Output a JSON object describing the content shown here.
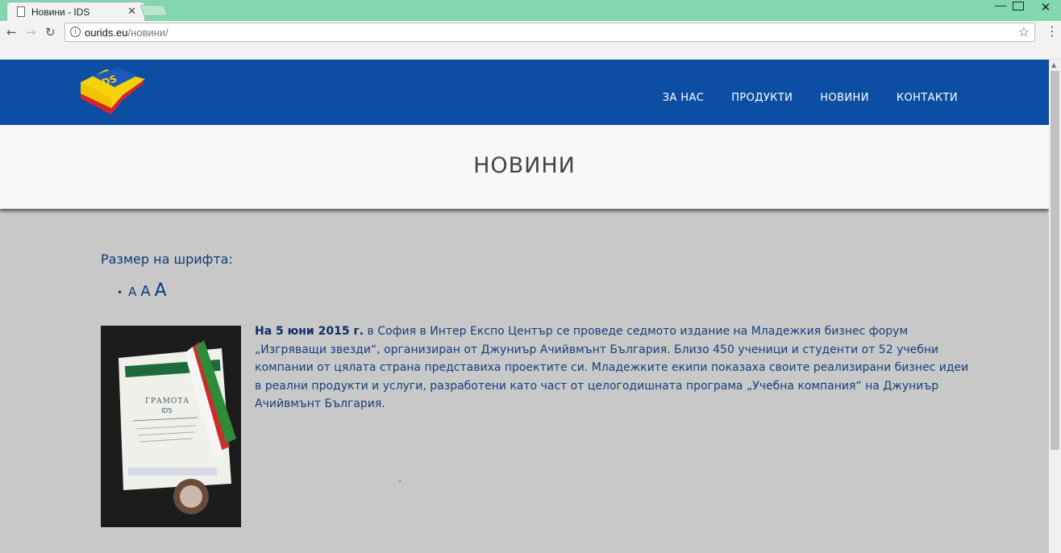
{
  "browser": {
    "tab_title": "Новини - IDS",
    "tab_close": "✕",
    "url_host": "ourids.eu",
    "url_path": "/новини/"
  },
  "site": {
    "logo_text": "IDS",
    "nav": [
      "ЗА НАС",
      "ПРОДУКТИ",
      "НОВИНИ",
      "КОНТАКТИ"
    ],
    "page_title": "НОВИНИ"
  },
  "font_size": {
    "label": "Размер на шрифта:",
    "options": [
      "A",
      "A",
      "A"
    ]
  },
  "article": {
    "date_bold": "На 5 юни 2015 г.",
    "text": " в София в Интер Експо Център се проведе седмото издание на Младежкия бизнес форум „Изгряващи звезди“, организиран от Джуниър Ачийвмънт България. Близо 450 ученици и студенти от 52 учебни компании от цялата страна представиха проектите си. Младежките екипи показаха своите реализирани бизнес идеи в реални продукти и услуги, разработени като част от целогодишната програма „Учебна компания“ на Джуниър Ачийвмънт България.",
    "photo": {
      "certificate_title": "ГРАМОТА",
      "certificate_name": "IDS"
    }
  },
  "colors": {
    "header_bg": "#0c4ea3",
    "titlebar": "#80d7b0",
    "text": "#163f7a"
  }
}
